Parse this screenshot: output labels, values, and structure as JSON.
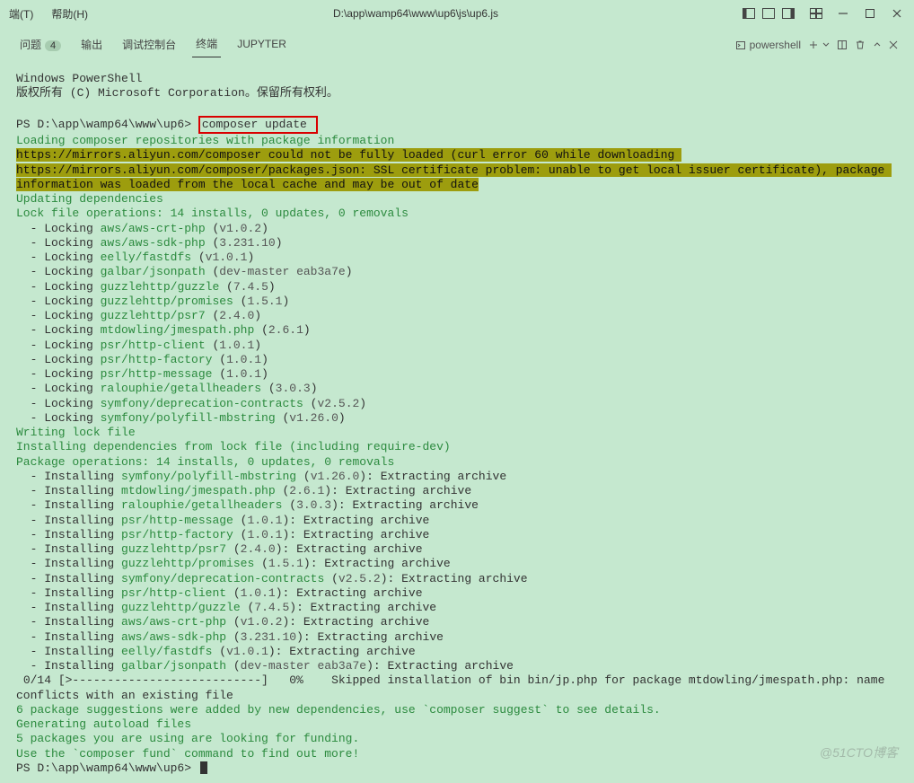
{
  "menu": {
    "terminal": "端(T)",
    "help": "帮助(H)"
  },
  "title": "D:\\app\\wamp64\\www\\up6\\js\\up6.js",
  "tabs": {
    "problems": "问题",
    "problems_count": "4",
    "output": "输出",
    "debug": "调试控制台",
    "terminal": "终端",
    "jupyter": "JUPYTER"
  },
  "shell_label": "powershell",
  "ps": {
    "l1": "Windows PowerShell",
    "l2": "版权所有 (C) Microsoft Corporation。保留所有权利。",
    "prompt1": "PS D:\\app\\wamp64\\www\\up6> ",
    "cmd": "composer update",
    "loading": "Loading composer repositories with package information",
    "warn": "https://mirrors.aliyun.com/composer could not be fully loaded (curl error 60 while downloading https://mirrors.aliyun.com/composer/packages.json: SSL certificate problem: unable to get local issuer certificate), package information was loaded from the local cache and may be out of date",
    "upd": "Updating dependencies",
    "lockops": "Lock file operations: 14 installs, 0 updates, 0 removals",
    "locks": [
      {
        "pkg": "aws/aws-crt-php",
        "ver": "v1.0.2"
      },
      {
        "pkg": "aws/aws-sdk-php",
        "ver": "3.231.10"
      },
      {
        "pkg": "eelly/fastdfs",
        "ver": "v1.0.1"
      },
      {
        "pkg": "galbar/jsonpath",
        "ver": "dev-master eab3a7e"
      },
      {
        "pkg": "guzzlehttp/guzzle",
        "ver": "7.4.5"
      },
      {
        "pkg": "guzzlehttp/promises",
        "ver": "1.5.1"
      },
      {
        "pkg": "guzzlehttp/psr7",
        "ver": "2.4.0"
      },
      {
        "pkg": "mtdowling/jmespath.php",
        "ver": "2.6.1"
      },
      {
        "pkg": "psr/http-client",
        "ver": "1.0.1"
      },
      {
        "pkg": "psr/http-factory",
        "ver": "1.0.1"
      },
      {
        "pkg": "psr/http-message",
        "ver": "1.0.1"
      },
      {
        "pkg": "ralouphie/getallheaders",
        "ver": "3.0.3"
      },
      {
        "pkg": "symfony/deprecation-contracts",
        "ver": "v2.5.2"
      },
      {
        "pkg": "symfony/polyfill-mbstring",
        "ver": "v1.26.0"
      }
    ],
    "writelock": "Writing lock file",
    "installdeps": "Installing dependencies from lock file (including require-dev)",
    "pkgops": "Package operations: 14 installs, 0 updates, 0 removals",
    "installs": [
      {
        "pkg": "symfony/polyfill-mbstring",
        "ver": "v1.26.0"
      },
      {
        "pkg": "mtdowling/jmespath.php",
        "ver": "2.6.1"
      },
      {
        "pkg": "ralouphie/getallheaders",
        "ver": "3.0.3"
      },
      {
        "pkg": "psr/http-message",
        "ver": "1.0.1"
      },
      {
        "pkg": "psr/http-factory",
        "ver": "1.0.1"
      },
      {
        "pkg": "guzzlehttp/psr7",
        "ver": "2.4.0"
      },
      {
        "pkg": "guzzlehttp/promises",
        "ver": "1.5.1"
      },
      {
        "pkg": "symfony/deprecation-contracts",
        "ver": "v2.5.2"
      },
      {
        "pkg": "psr/http-client",
        "ver": "1.0.1"
      },
      {
        "pkg": "guzzlehttp/guzzle",
        "ver": "7.4.5"
      },
      {
        "pkg": "aws/aws-crt-php",
        "ver": "v1.0.2"
      },
      {
        "pkg": "aws/aws-sdk-php",
        "ver": "3.231.10"
      },
      {
        "pkg": "eelly/fastdfs",
        "ver": "v1.0.1"
      },
      {
        "pkg": "galbar/jsonpath",
        "ver": "dev-master eab3a7e"
      }
    ],
    "extract": ": Extracting archive",
    "progress_a": " 0/14 [>---------------------------]   0%",
    "skipmsg": "    Skipped installation of bin bin/jp.php for package mtdowling/jmespath.php: name conflicts with an existing file",
    "sugg": "6 package suggestions were added by new dependencies, use `composer suggest` to see details.",
    "autoload": "Generating autoload files",
    "funding": "5 packages you are using are looking for funding.",
    "fundcmd": "Use the `composer fund` command to find out more!",
    "prompt2": "PS D:\\app\\wamp64\\www\\up6> "
  },
  "watermark": "@51CTO博客"
}
